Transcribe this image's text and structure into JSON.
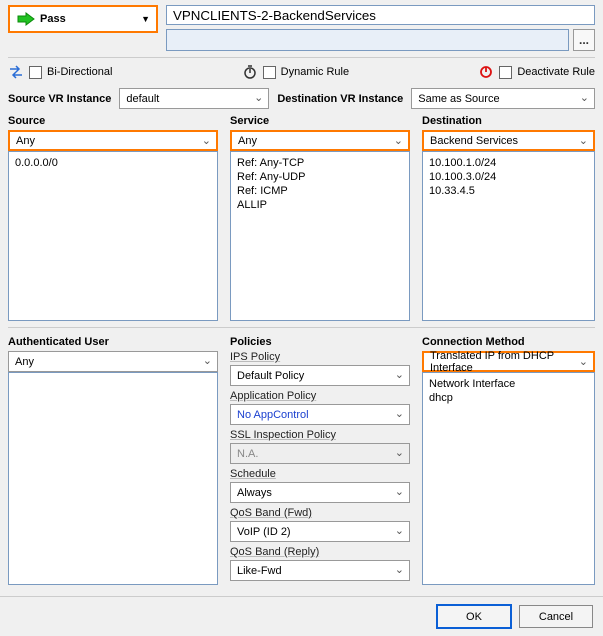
{
  "action": {
    "label": "Pass"
  },
  "rule": {
    "name": "VPNCLIENTS-2-BackendServices",
    "description": ""
  },
  "options": {
    "bidi": {
      "label": "Bi-Directional",
      "checked": false
    },
    "dynamic": {
      "label": "Dynamic Rule",
      "checked": false
    },
    "deactivate": {
      "label": "Deactivate Rule",
      "checked": false
    }
  },
  "vr": {
    "src_label": "Source VR Instance",
    "src_value": "default",
    "dst_label": "Destination VR Instance",
    "dst_value": "Same as Source"
  },
  "source": {
    "label": "Source",
    "selector": "Any",
    "items": [
      "0.0.0.0/0"
    ]
  },
  "service": {
    "label": "Service",
    "selector": "Any",
    "items": [
      "Ref: Any-TCP",
      "Ref: Any-UDP",
      "Ref: ICMP",
      "ALLIP"
    ]
  },
  "destination": {
    "label": "Destination",
    "selector": "Backend Services",
    "items": [
      "10.100.1.0/24",
      "10.100.3.0/24",
      "10.33.4.5"
    ]
  },
  "auth_user": {
    "label": "Authenticated User",
    "selector": "Any"
  },
  "policies": {
    "label": "Policies",
    "ips": {
      "label": "IPS Policy",
      "value": "Default Policy"
    },
    "app": {
      "label": "Application Policy",
      "value": "No AppControl"
    },
    "ssl": {
      "label": "SSL Inspection Policy",
      "value": "N.A."
    },
    "schedule": {
      "label": "Schedule",
      "value": "Always"
    },
    "qos_fwd": {
      "label": "QoS Band (Fwd)",
      "value": "VoIP (ID 2)"
    },
    "qos_reply": {
      "label": "QoS Band (Reply)",
      "value": "Like-Fwd"
    }
  },
  "connection_method": {
    "label": "Connection Method",
    "selector": "Translated IP from DHCP Interface",
    "items": [
      "Network Interface",
      "dhcp"
    ]
  },
  "buttons": {
    "ok": "OK",
    "cancel": "Cancel"
  },
  "glyphs": {
    "ellipsis": "..."
  }
}
